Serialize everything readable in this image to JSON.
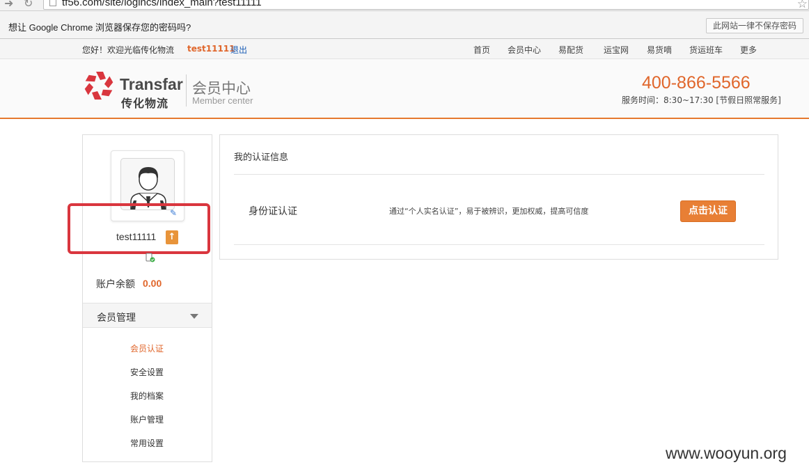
{
  "browser": {
    "url": "tf56.com/site/logincs/index_main?test11111",
    "infobar_prompt": "想让 Google Chrome 浏览器保存您的密码吗?",
    "never_save_label": "此网站一律不保存密码"
  },
  "topbar": {
    "welcome": "您好！欢迎光临传化物流",
    "username": "test11111",
    "logout": "退出",
    "nav": [
      "首页",
      "会员中心",
      "易配货",
      "运宝网",
      "易货嘀",
      "货运班车",
      "更多"
    ]
  },
  "header": {
    "logo_en": "Transfar",
    "logo_cn": "传化物流",
    "member_center": "会员中心",
    "member_center_en": "Member center",
    "hotline": "400-866-5566",
    "service_time": "服务时间：8:30~17:30 [节假日照常服务]",
    "brand_color": "#e0662b"
  },
  "sidebar": {
    "username": "test11111",
    "balance_label": "账户余额",
    "balance_value": "0.00",
    "menu_title": "会员管理",
    "menu_items": [
      "会员认证",
      "安全设置",
      "我的档案",
      "账户管理",
      "常用设置"
    ],
    "active_index": 0
  },
  "main": {
    "title": "我的认证信息",
    "rows": [
      {
        "label": "身份证认证",
        "description": "通过“个人实名认证”，易于被辨识，更加权威，提高可信度",
        "button": "点击认证"
      }
    ]
  },
  "watermark": "www.wooyun.org",
  "icons": [
    "back-icon",
    "reload-icon",
    "page-icon",
    "star-icon",
    "logo-icon",
    "avatar-icon",
    "edit-icon",
    "upgrade-icon",
    "phone-verified-icon",
    "caret-down-icon"
  ]
}
